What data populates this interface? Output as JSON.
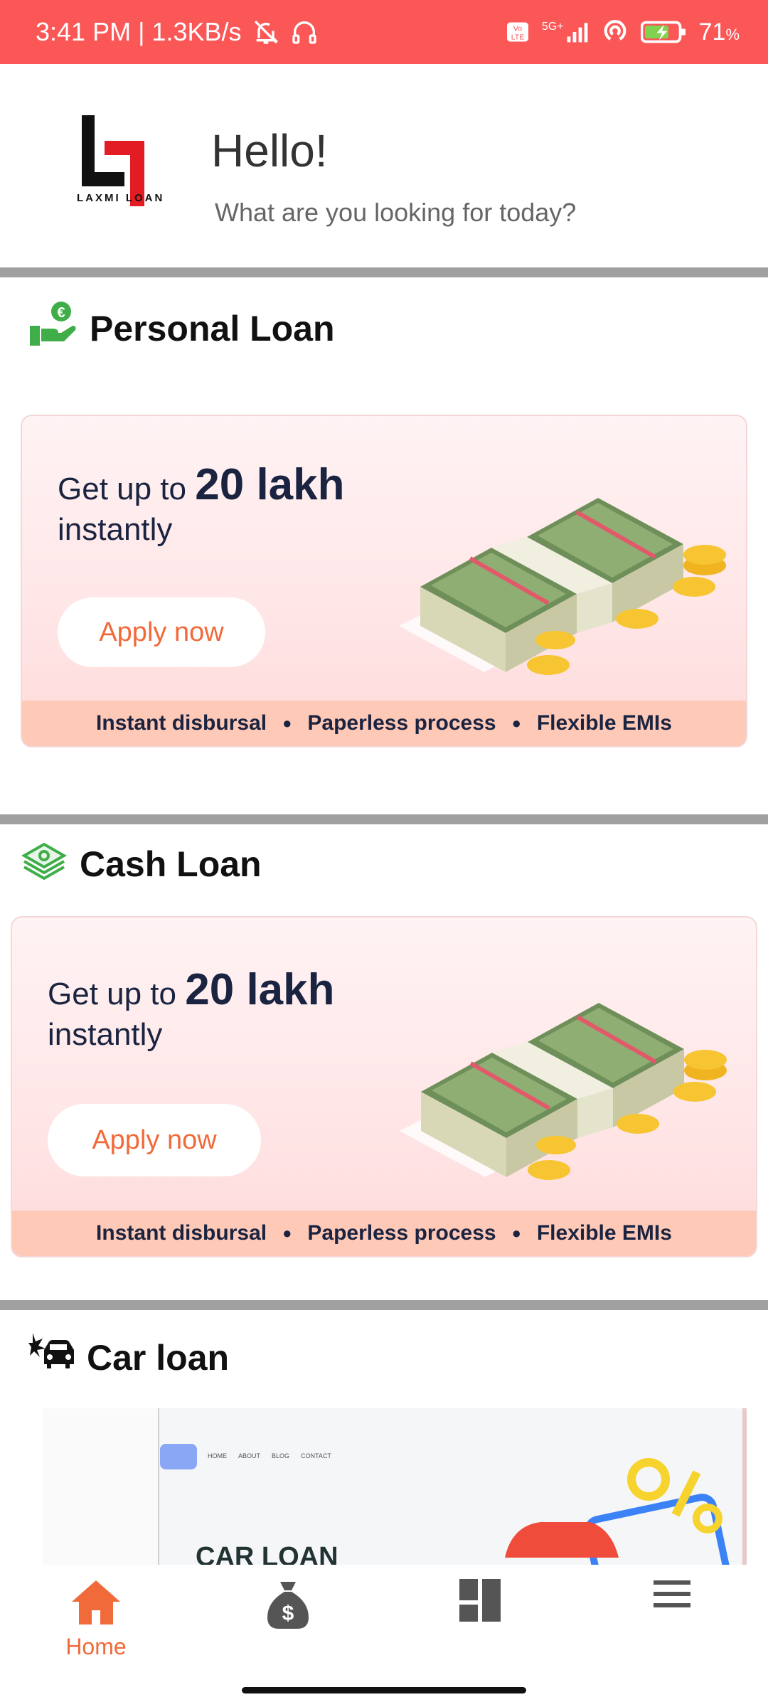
{
  "status_bar": {
    "time_speed": "3:41 PM | 1.3KB/s",
    "network": "5G+",
    "battery": "71"
  },
  "header": {
    "logo_text": "LAXMI LOAN",
    "greeting": "Hello!",
    "subtitle": "What are you looking for today?"
  },
  "sections": {
    "personal": {
      "title": "Personal Loan",
      "headline_prefix": "Get up to",
      "headline_amount": "20 lakh",
      "headline_suffix": "instantly",
      "apply_label": "Apply now",
      "features": [
        "Instant disbursal",
        "Paperless process",
        "Flexible EMIs"
      ]
    },
    "cash": {
      "title": "Cash Loan",
      "headline_prefix": "Get up to",
      "headline_amount": "20 lakh",
      "headline_suffix": "instantly",
      "apply_label": "Apply now",
      "features": [
        "Instant disbursal",
        "Paperless process",
        "Flexible EMIs"
      ]
    },
    "car": {
      "title": "Car loan",
      "preview_nav": [
        "HOME",
        "ABOUT",
        "BLOG",
        "CONTACT"
      ],
      "preview_heading": "CAR LOAN"
    }
  },
  "bottom_nav": {
    "home_label": "Home",
    "accent": "#f06a3a"
  },
  "colors": {
    "status_bar": "#fb5757",
    "brand_red": "#e31b23",
    "icon_green": "#3fae49"
  },
  "icons": [
    "bell-off-icon",
    "headphones-icon",
    "signal-icon",
    "hotspot-icon",
    "battery-icon",
    "hand-coin-icon",
    "cash-stack-icon",
    "car-crash-icon",
    "home-icon",
    "money-bag-icon",
    "dashboard-icon",
    "menu-icon"
  ]
}
